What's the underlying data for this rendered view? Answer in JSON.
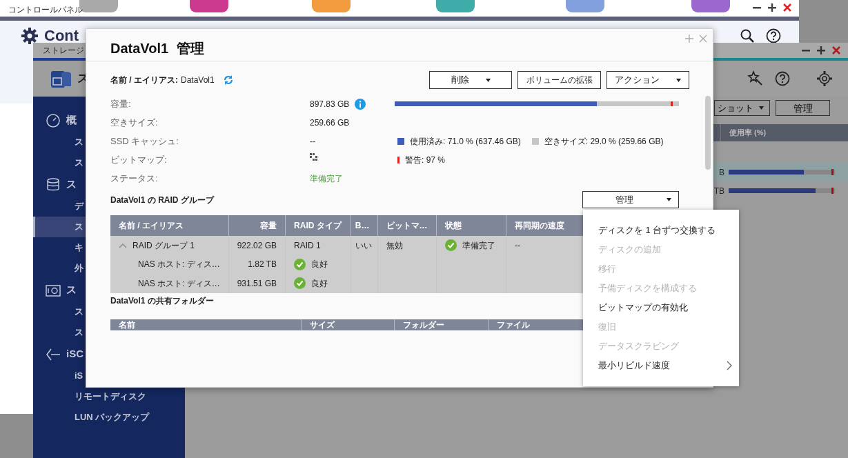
{
  "control_panel": {
    "title": "コントロールパネル",
    "heading": "Cont"
  },
  "storage_window": {
    "title": "ストレージ",
    "header_title": "ス",
    "sidebar": [
      {
        "kind": "section",
        "label": "概",
        "selected": false
      },
      {
        "kind": "item",
        "label": "ス",
        "selected": false
      },
      {
        "kind": "item",
        "label": "ス",
        "selected": false
      },
      {
        "kind": "section",
        "label": "ス",
        "selected": false
      },
      {
        "kind": "item",
        "label": "デ",
        "selected": false
      },
      {
        "kind": "item",
        "label": "ス",
        "selected": true
      },
      {
        "kind": "item",
        "label": "キ",
        "selected": false
      },
      {
        "kind": "item",
        "label": "外",
        "selected": false
      },
      {
        "kind": "section",
        "label": "ス",
        "selected": false
      },
      {
        "kind": "item",
        "label": "ス",
        "selected": false
      },
      {
        "kind": "item",
        "label": "ス",
        "selected": false
      },
      {
        "kind": "section",
        "label": "iSC",
        "selected": false
      },
      {
        "kind": "item",
        "label": "iS",
        "selected": false
      },
      {
        "kind": "item",
        "label": "リモートディスク",
        "selected": false
      },
      {
        "kind": "item",
        "label": "LUN バックアップ",
        "selected": false
      }
    ],
    "toolbar": {
      "dropdown": "ショット",
      "button": "管理"
    },
    "table": {
      "columns": [
        "使用率 (%)"
      ],
      "rows": [
        {
          "capacity": "B",
          "level": 0.71,
          "warning_marker": {
            "level": 0.97
          },
          "selected": true
        },
        {
          "capacity": "TB",
          "level": 0.82,
          "warning_marker": {
            "level": 0.97
          },
          "selected": false
        }
      ]
    }
  },
  "dialog": {
    "title": "DataVol1 管理",
    "name_label": "名前 / エイリアス:",
    "name_value": "DataVol1",
    "buttons": [
      {
        "label": "削除",
        "dropdown": true
      },
      {
        "label": "ボリュームの拡張",
        "dropdown": false
      },
      {
        "label": "アクション",
        "dropdown": true
      }
    ],
    "properties": [
      {
        "label": "容量:",
        "value": "897.83 GB",
        "kind": "info"
      },
      {
        "label": "空きサイズ:",
        "value": "259.66 GB",
        "kind": "text"
      },
      {
        "label": "SSD キャッシュ:",
        "value": "--",
        "kind": "text"
      },
      {
        "label": "ビットマップ:",
        "kind": "bitmap"
      },
      {
        "label": "ステータス:",
        "value": "準備完了",
        "kind": "status"
      }
    ],
    "usage": {
      "level": 0.71,
      "warning_marker": {
        "level": 0.97
      }
    },
    "legend": [
      {
        "label": "使用済み: 71.0 % (637.46 GB)",
        "color": "#3f5bbd"
      },
      {
        "label": "空きサイズ: 29.0 % (259.66 GB)",
        "color": "#c6c6c6"
      }
    ],
    "warning": {
      "label": "警告: 97 %",
      "color": "#e3221f"
    },
    "raid_title": "DataVol1 の RAID グループ",
    "raid_button": "管理",
    "raid_table": {
      "columns": [
        "名前 / エイリアス",
        "容量",
        "RAID タイプ",
        "B…",
        "ビットマ…",
        "状態",
        "再同期の速度"
      ],
      "rows": [
        {
          "kind": "group",
          "expanded": true,
          "cells": [
            {
              "text": "RAID グループ 1",
              "kind": "text"
            },
            {
              "text": "922.02 GB",
              "kind": "text"
            },
            {
              "text": "RAID 1",
              "kind": "text"
            },
            {
              "text": "いい",
              "kind": "text"
            },
            {
              "text": "無効",
              "kind": "text"
            },
            {
              "text": "準備完了",
              "kind": "status"
            },
            {
              "text": "--",
              "kind": "text"
            }
          ]
        },
        {
          "kind": "disk",
          "cells": [
            {
              "text": "NAS ホスト: ディス…",
              "kind": "text"
            },
            {
              "text": "1.82 TB",
              "kind": "text"
            },
            {
              "text": "良好",
              "kind": "status"
            }
          ]
        },
        {
          "kind": "disk",
          "cells": [
            {
              "text": "NAS ホスト: ディス…",
              "kind": "text"
            },
            {
              "text": "931.51 GB",
              "kind": "text"
            },
            {
              "text": "良好",
              "kind": "status"
            }
          ]
        }
      ]
    },
    "shared_title": "DataVol1 の共有フォルダー",
    "shared_table": {
      "columns": [
        "名前",
        "サイズ",
        "フォルダー",
        "ファイル"
      ]
    }
  },
  "menu": {
    "items": [
      {
        "label": "ディスクを 1 台ずつ交換する",
        "disabled": false,
        "has_submenu": false
      },
      {
        "label": "ディスクの追加",
        "disabled": true,
        "has_submenu": false
      },
      {
        "label": "移行",
        "disabled": true,
        "has_submenu": false
      },
      {
        "label": "予備ディスクを構成する",
        "disabled": true,
        "has_submenu": false
      },
      {
        "label": "ビットマップの有効化",
        "disabled": false,
        "has_submenu": false
      },
      {
        "label": "復旧",
        "disabled": true,
        "has_submenu": false
      },
      {
        "label": "データスクラビング",
        "disabled": true,
        "has_submenu": false
      },
      {
        "label": "最小リビルド速度",
        "disabled": false,
        "has_submenu": true
      }
    ]
  }
}
